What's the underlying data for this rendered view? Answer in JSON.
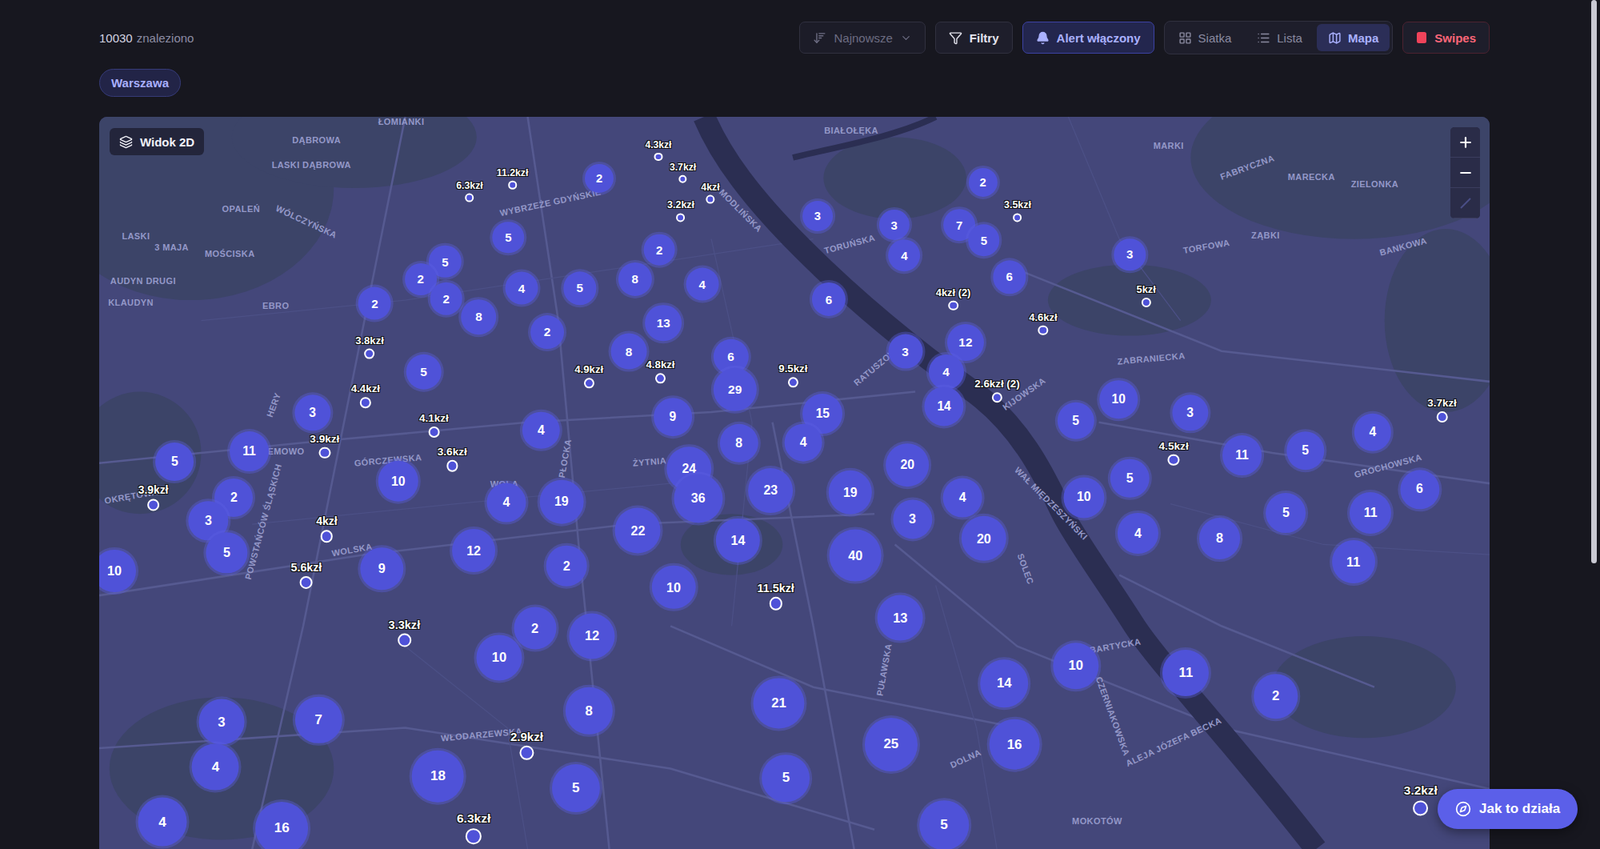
{
  "results": {
    "count": "10030",
    "label": "znaleziono"
  },
  "toolbar": {
    "sort": {
      "label": "Najnowsze",
      "disabled": true
    },
    "filters": "Filtry",
    "alert": {
      "label": "Alert włączony",
      "on": true
    },
    "views": [
      {
        "label": "Siatka",
        "selected": false
      },
      {
        "label": "Lista",
        "selected": false
      },
      {
        "label": "Mapa",
        "selected": true
      }
    ],
    "swipes": "Swipes"
  },
  "chips": [
    {
      "label": "Warszawa"
    }
  ],
  "map": {
    "mode_button": "Widok 2D",
    "labels": [
      "ŁOMIANKI",
      "DĄBROWA",
      "LASKI DĄBROWA",
      "BIAŁOŁĘKA",
      "MARKI",
      "FABRYCZNA",
      "MARECKA",
      "ZIELONKA",
      "OPALEŃ",
      "WÓLCZYŃSKA",
      "LASKI",
      "3 MAJA",
      "MOŚCISKA",
      "ZĄBKI",
      "TORFOWA",
      "BANKOWA",
      "AUDYN DRUGI",
      "KLAUDYN",
      "EBRO",
      "WYBRZEŻE GDYŃSKIE",
      "MODLIŃSKA",
      "TORUŃSKA",
      "RATUSZOWA",
      "ZABRANIECKA",
      "KIJOWSKA",
      "HERY",
      "EMOWO",
      "GÓRCZEWSKA",
      "PŁOCKA",
      "ŻYTNIA",
      "WOLA",
      "GROCHOWSKA",
      "WAŁ MIĘDZESZYŃSKI",
      "OKRĘTOWA",
      "POWSTAŃCÓW ŚLĄSKICH",
      "WOLSKA",
      "SOLEC",
      "PUŁAWSKA",
      "BARTYCKA",
      "CZERNIAKOWSKA",
      "WŁODARZEWSKA",
      "DOLNA",
      "ALEJA JÓZEFA BECKA",
      "MOKOTÓW"
    ],
    "clusters": [
      "2",
      "3",
      "3",
      "7",
      "5",
      "2",
      "4",
      "6",
      "3",
      "5",
      "5",
      "2",
      "2",
      "2",
      "4",
      "5",
      "8",
      "2",
      "4",
      "8",
      "2",
      "13",
      "8",
      "6",
      "6",
      "29",
      "12",
      "3",
      "4",
      "14",
      "5",
      "3",
      "11",
      "5",
      "4",
      "9",
      "15",
      "4",
      "8",
      "24",
      "36",
      "23",
      "19",
      "20",
      "4",
      "3",
      "20",
      "40",
      "5",
      "10",
      "3",
      "11",
      "5",
      "4",
      "5",
      "10",
      "4",
      "8",
      "5",
      "11",
      "6",
      "11",
      "10",
      "2",
      "3",
      "5",
      "10",
      "4",
      "19",
      "22",
      "12",
      "2",
      "10",
      "14",
      "9",
      "13",
      "2",
      "12",
      "10",
      "3",
      "7",
      "4",
      "8",
      "21",
      "25",
      "14",
      "10",
      "11",
      "2",
      "16",
      "18",
      "5",
      "5",
      "5",
      "4",
      "16"
    ],
    "pins": [
      "6.3kzł",
      "11.2kzł",
      "4.3kzł",
      "3.7kzł",
      "4kzł",
      "3.2kzł",
      "3.5kzł",
      "4kzł (2)",
      "5kzł",
      "4.6kzł",
      "3.8kzł",
      "4.9kzł",
      "4.8kzł",
      "9.5kzł",
      "2.6kzł (2)",
      "3.7kzł",
      "4.4kzł",
      "4.1kzł",
      "3.9kzł",
      "3.6kzł",
      "4.5kzł",
      "3.9kzł",
      "4kzł",
      "5.6kzł",
      "11.5kzł",
      "3.3kzł",
      "2.9kzł",
      "6.3kzł",
      "3.2kzł"
    ]
  },
  "help_button": "Jak to działa"
}
